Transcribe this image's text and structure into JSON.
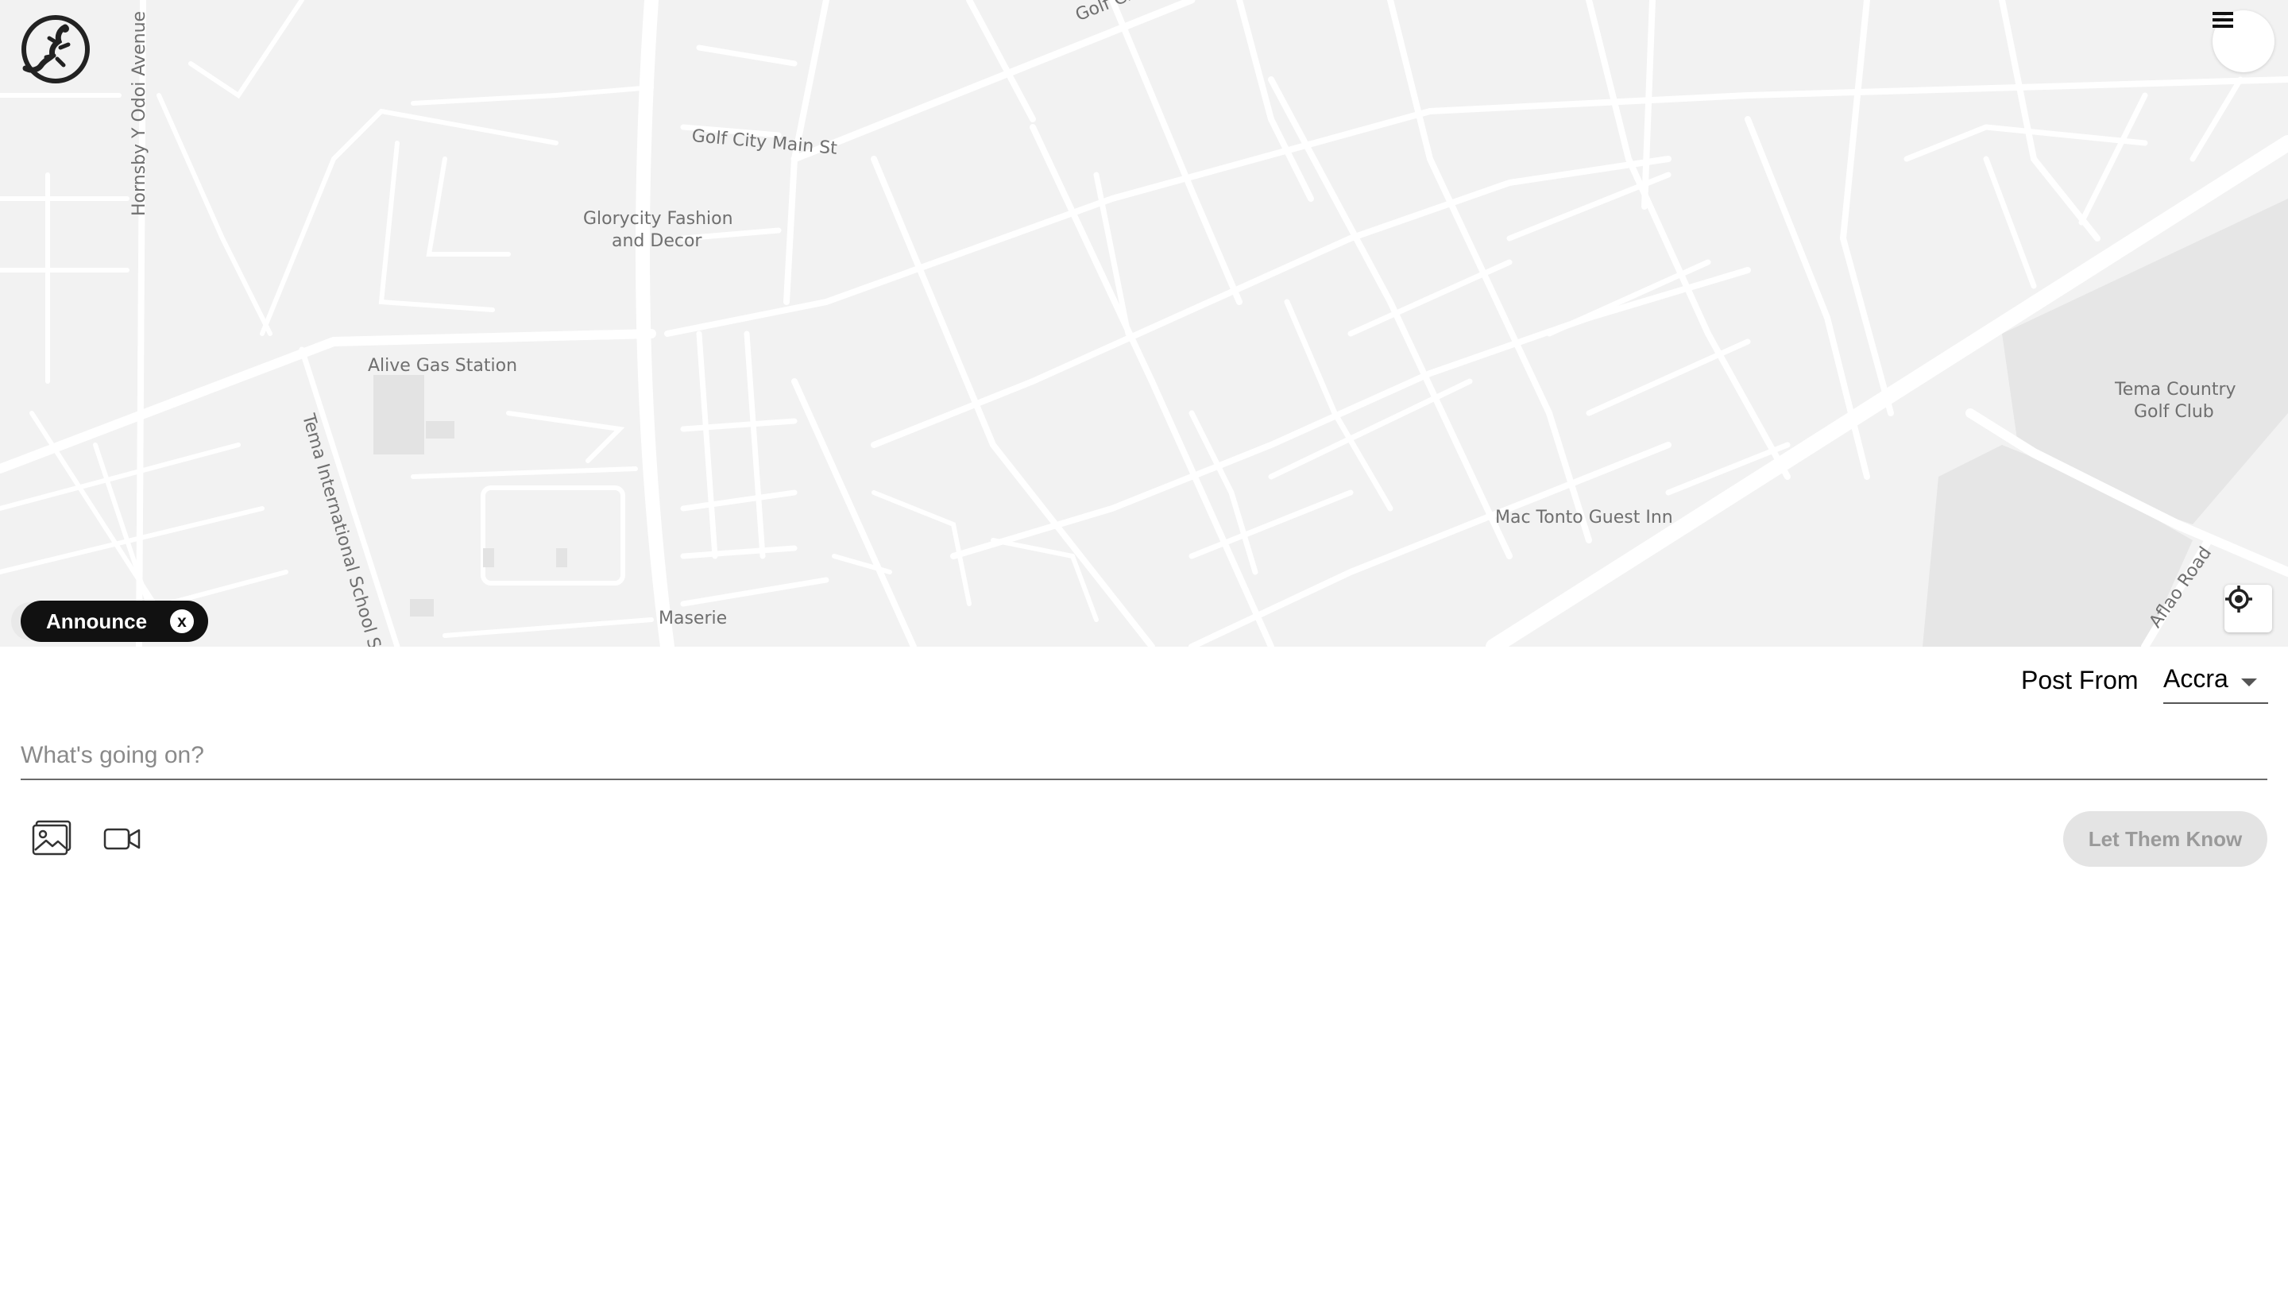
{
  "map": {
    "labels": {
      "golf_city_main_top": "Golf City Main",
      "golf_city_main_st": "Golf City Main St",
      "hornsby": "Hornsby Y Odoi Avenue",
      "glorycity_line1": "Glorycity Fashion",
      "glorycity_line2": "and Decor",
      "alive_gas": "Alive Gas Station",
      "tema_school": "Tema International School St",
      "maserie": "Maserie",
      "mac_tonto": "Mac Tonto Guest Inn",
      "tema_golf_line1": "Tema Country",
      "tema_golf_line2": "Golf Club",
      "aflao_road": "Aflao Road"
    },
    "colors": {
      "land": "#f2f2f2",
      "road": "#ffffff",
      "park": "#e6e6e6"
    }
  },
  "header": {
    "logo_icon": "gecko-logo-icon",
    "menu_icon": "hamburger-menu-icon"
  },
  "map_controls": {
    "locate_icon": "crosshair-locate-icon"
  },
  "tag": {
    "label": "Announce",
    "close": "x"
  },
  "composer": {
    "post_from_label": "Post From",
    "post_from_value": "Accra",
    "placeholder": "What's going on?",
    "value": "",
    "image_icon": "image-icon",
    "video_icon": "video-camera-icon",
    "submit_label": "Let Them Know"
  }
}
